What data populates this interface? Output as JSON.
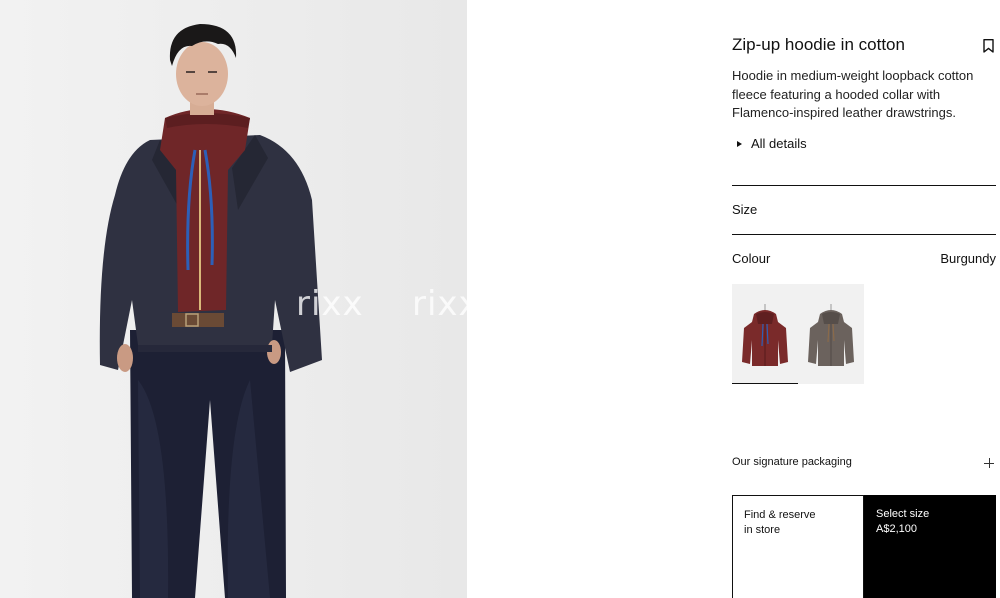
{
  "product": {
    "title": "Zip-up hoodie in cotton",
    "description": "Hoodie in medium-weight loopback cotton fleece featuring a hooded collar with Flamenco-inspired leather drawstrings.",
    "details_label": "All details"
  },
  "hero_image": {
    "alt": "model-wearing-burgundy-zip-up-hoodie-under-navy-jacket",
    "watermark": [
      "rixx",
      "rixx"
    ],
    "background_color": "#eeeeee"
  },
  "size": {
    "label": "Size"
  },
  "colour": {
    "label": "Colour",
    "selected": "Burgundy",
    "swatches": [
      {
        "name": "burgundy",
        "color": "#7a2a2a",
        "selected": true
      },
      {
        "name": "grey-brown",
        "color": "#6b625d",
        "selected": false
      }
    ]
  },
  "packaging": {
    "label": "Our signature packaging"
  },
  "actions": {
    "store_line1": "Find & reserve",
    "store_line2": "in store",
    "buy_line1": "Select size",
    "price": "A$2,100"
  },
  "icons": {
    "bookmark": "bookmark-icon",
    "expand": "plus-icon",
    "details": "triangle-right-icon"
  }
}
